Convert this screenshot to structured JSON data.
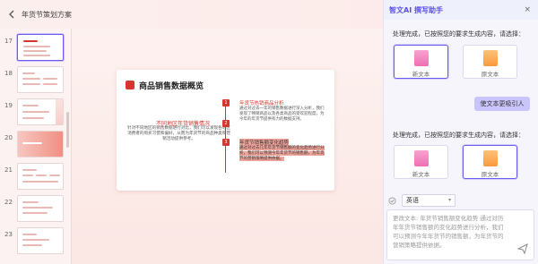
{
  "topbar": {
    "title": "年货节策划方案"
  },
  "thumbnails": [
    {
      "num": "17",
      "selected": true
    },
    {
      "num": "18",
      "selected": false
    },
    {
      "num": "19",
      "selected": false
    },
    {
      "num": "20",
      "selected": false
    },
    {
      "num": "21",
      "selected": false
    },
    {
      "num": "22",
      "selected": false
    },
    {
      "num": "23",
      "selected": false
    }
  ],
  "slide": {
    "title": "商品销售数据概览",
    "left_heading": "不同地区年货销售情况",
    "left_body": "针对不同地区的销售数据进行对比，我们可以发现各地区消费者的购买习惯和偏好，从而为年货节的商品种类和营销活动提供参考。",
    "points": [
      {
        "num": "1",
        "heading": "年货节热销商品分析",
        "body": "通过对过去一年的销售数据进行深入分析，我们发现了畅销商品以及各类商品的受欢迎程度，为今年的年货节提供有力的数据支持。"
      },
      {
        "num": "2",
        "heading": "",
        "body": ""
      },
      {
        "num": "3",
        "heading": "年货节销售额变化趋势",
        "body": "通过对过去几年年货节销售额的变化趋势进行分析，我们可以预测今年年货节的销售额，为年货节的营销策略提供依据。"
      }
    ]
  },
  "panel": {
    "brand": "智文AI 撰写助手",
    "close_icon": "×",
    "msg1": "处理完成，已按照您的要求生成内容，请选择：",
    "opt_new": "新文本",
    "opt_old": "原文本",
    "user_msg": "使文本更吸引人",
    "msg2": "处理完成，已按照您的要求生成内容，请选择：",
    "language": "英语",
    "input_placeholder": "更改文本: 年货节销售额变化趋势 通过对历年年货节销售额的变化趋势进行分析，我们可以预测今年年货节的销售额，为年货节的营销策略提供依据。"
  }
}
